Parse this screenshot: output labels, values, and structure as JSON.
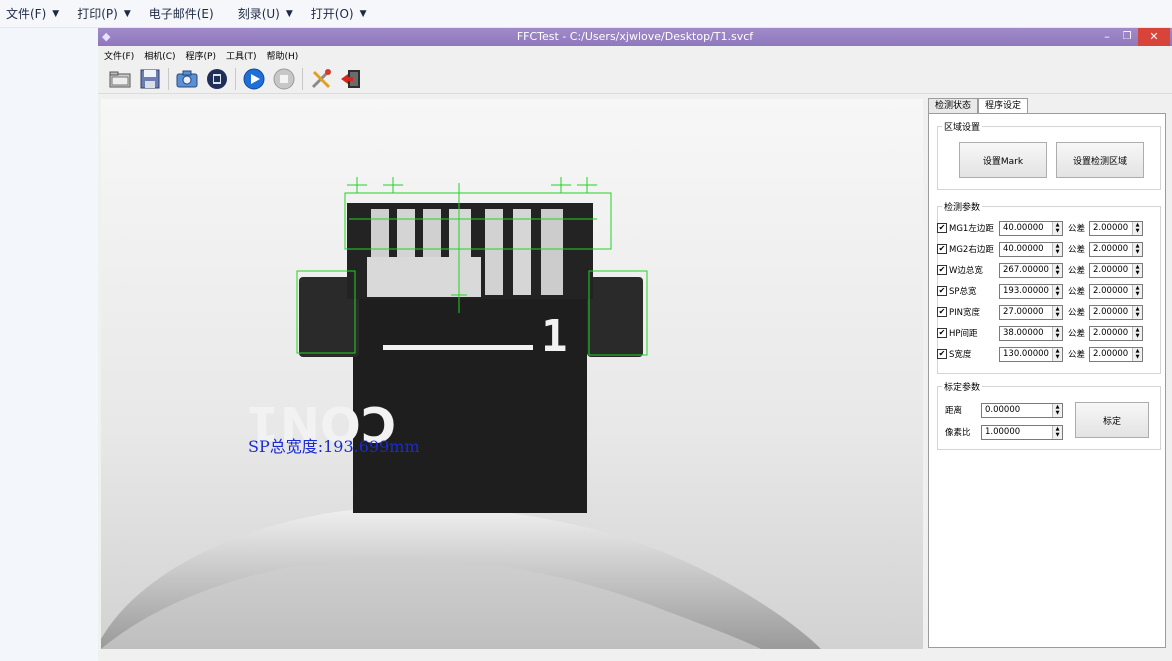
{
  "outer_menu": {
    "items": [
      {
        "label": "文件(F)",
        "arrow": "▼"
      },
      {
        "label": "打印(P)",
        "arrow": "▼"
      },
      {
        "label": "电子邮件(E)",
        "arrow": ""
      },
      {
        "label": "刻录(U)",
        "arrow": "▼"
      },
      {
        "label": "打开(O)",
        "arrow": "▼"
      }
    ]
  },
  "window": {
    "title": "FFCTest - C:/Users/xjwlove/Desktop/T1.svcf",
    "min_icon": "–",
    "max_icon": "❐",
    "close_icon": "✕"
  },
  "app_menu": [
    "文件(F)",
    "相机(C)",
    "程序(P)",
    "工具(T)",
    "帮助(H)"
  ],
  "toolbar": {
    "icons": [
      "open-folder-icon",
      "save-icon",
      "camera-icon",
      "video-icon",
      "play-icon",
      "stop-icon",
      "tools-icon",
      "exit-icon"
    ]
  },
  "viewer": {
    "measure_label": "SP总宽度:193.699mm",
    "part_number_label": "1",
    "part_text": "CON1",
    "measure_color": "#1a2bd1",
    "box_color": "#22d322"
  },
  "tabs": [
    "检测状态",
    "程序设定"
  ],
  "region": {
    "legend": "区域设置",
    "set_mark_label": "设置Mark",
    "set_region_label": "设置检测区域"
  },
  "params": {
    "legend": "检测参数",
    "tolerance_label": "公差",
    "rows": [
      {
        "label": "MG1左边距",
        "value": "40.00000",
        "tol": "2.00000",
        "checked": "✔"
      },
      {
        "label": "MG2右边距",
        "value": "40.00000",
        "tol": "2.00000",
        "checked": "✔"
      },
      {
        "label": "W边总宽",
        "value": "267.00000",
        "tol": "2.00000",
        "checked": "✔"
      },
      {
        "label": "SP总宽",
        "value": "193.00000",
        "tol": "2.00000",
        "checked": "✔"
      },
      {
        "label": "PIN宽度",
        "value": "27.00000",
        "tol": "2.00000",
        "checked": "✔"
      },
      {
        "label": "HP间距",
        "value": "38.00000",
        "tol": "2.00000",
        "checked": "✔"
      },
      {
        "label": "S宽度",
        "value": "130.00000",
        "tol": "2.00000",
        "checked": "✔"
      }
    ]
  },
  "calib": {
    "legend": "标定参数",
    "distance_label": "距离",
    "distance_value": "0.00000",
    "ratio_label": "像素比",
    "ratio_value": "1.00000",
    "calibrate_label": "标定"
  }
}
